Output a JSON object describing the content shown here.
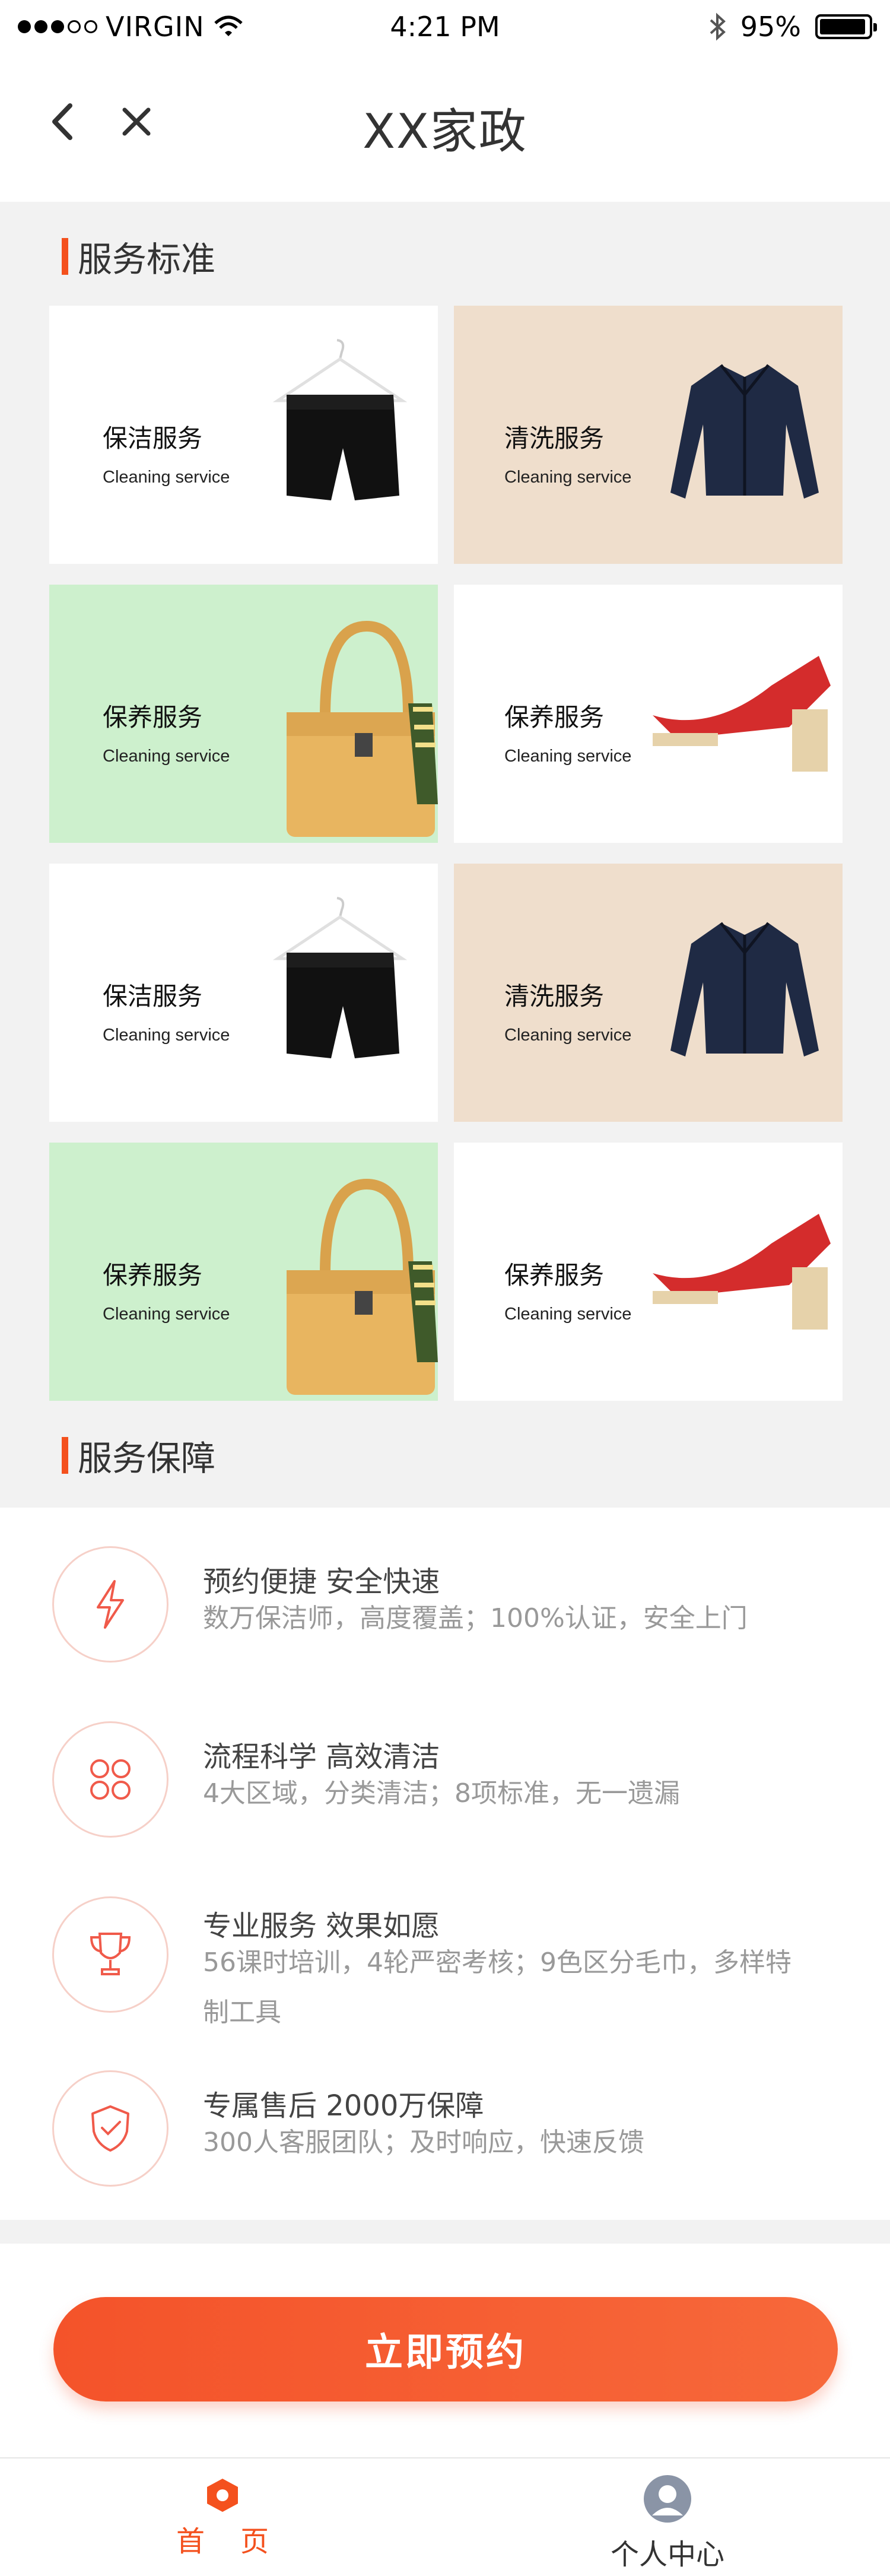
{
  "status_bar": {
    "carrier": "VIRGIN",
    "time": "4:21 PM",
    "battery": "95%",
    "battery_level": 0.95
  },
  "nav": {
    "title": "XX家政",
    "back_icon": "chevron-left-icon",
    "close_icon": "close-icon"
  },
  "standards": {
    "title": "服务标准",
    "cards": [
      {
        "title": "保洁服务",
        "subtitle": "Cleaning service",
        "image": "shorts-on-hanger",
        "bg": "#ffffff"
      },
      {
        "title": "清洗服务",
        "subtitle": "Cleaning service",
        "image": "leather-jacket",
        "bg": "#efdecc"
      },
      {
        "title": "保养服务",
        "subtitle": "Cleaning service",
        "image": "yellow-handbag",
        "bg": "#cdf0cd"
      },
      {
        "title": "保养服务",
        "subtitle": "Cleaning service",
        "image": "red-sandal",
        "bg": "#ffffff"
      },
      {
        "title": "保洁服务",
        "subtitle": "Cleaning service",
        "image": "shorts-on-hanger",
        "bg": "#ffffff"
      },
      {
        "title": "清洗服务",
        "subtitle": "Cleaning service",
        "image": "leather-jacket",
        "bg": "#efdecc"
      },
      {
        "title": "保养服务",
        "subtitle": "Cleaning service",
        "image": "yellow-handbag",
        "bg": "#cdf0cd"
      },
      {
        "title": "保养服务",
        "subtitle": "Cleaning service",
        "image": "red-sandal",
        "bg": "#ffffff"
      }
    ]
  },
  "guarantee": {
    "title": "服务保障",
    "items": [
      {
        "icon": "lightning-icon",
        "heading": "预约便捷 安全快速",
        "desc": "数万保洁师，高度覆盖；100%认证，安全上门"
      },
      {
        "icon": "grid-circles-icon",
        "heading": "流程科学 高效清洁",
        "desc": "4大区域，分类清洁；8项标准，无一遗漏"
      },
      {
        "icon": "trophy-icon",
        "heading": "专业服务 效果如愿",
        "desc": "56课时培训，4轮严密考核；9色区分毛巾，多样特制工具"
      },
      {
        "icon": "shield-check-icon",
        "heading": "专属售后 2000万保障",
        "desc": "300人客服团队；及时响应，快速反馈"
      }
    ]
  },
  "cta": {
    "label": "立即预约"
  },
  "tabs": [
    {
      "label": "首页",
      "icon": "home-icon",
      "active": true
    },
    {
      "label": "个人中心",
      "icon": "user-icon",
      "active": false
    }
  ],
  "colors": {
    "accent": "#f4511e",
    "page_bg": "#f2f2f2",
    "card_tan": "#efdecc",
    "card_green": "#cdf0cd"
  }
}
